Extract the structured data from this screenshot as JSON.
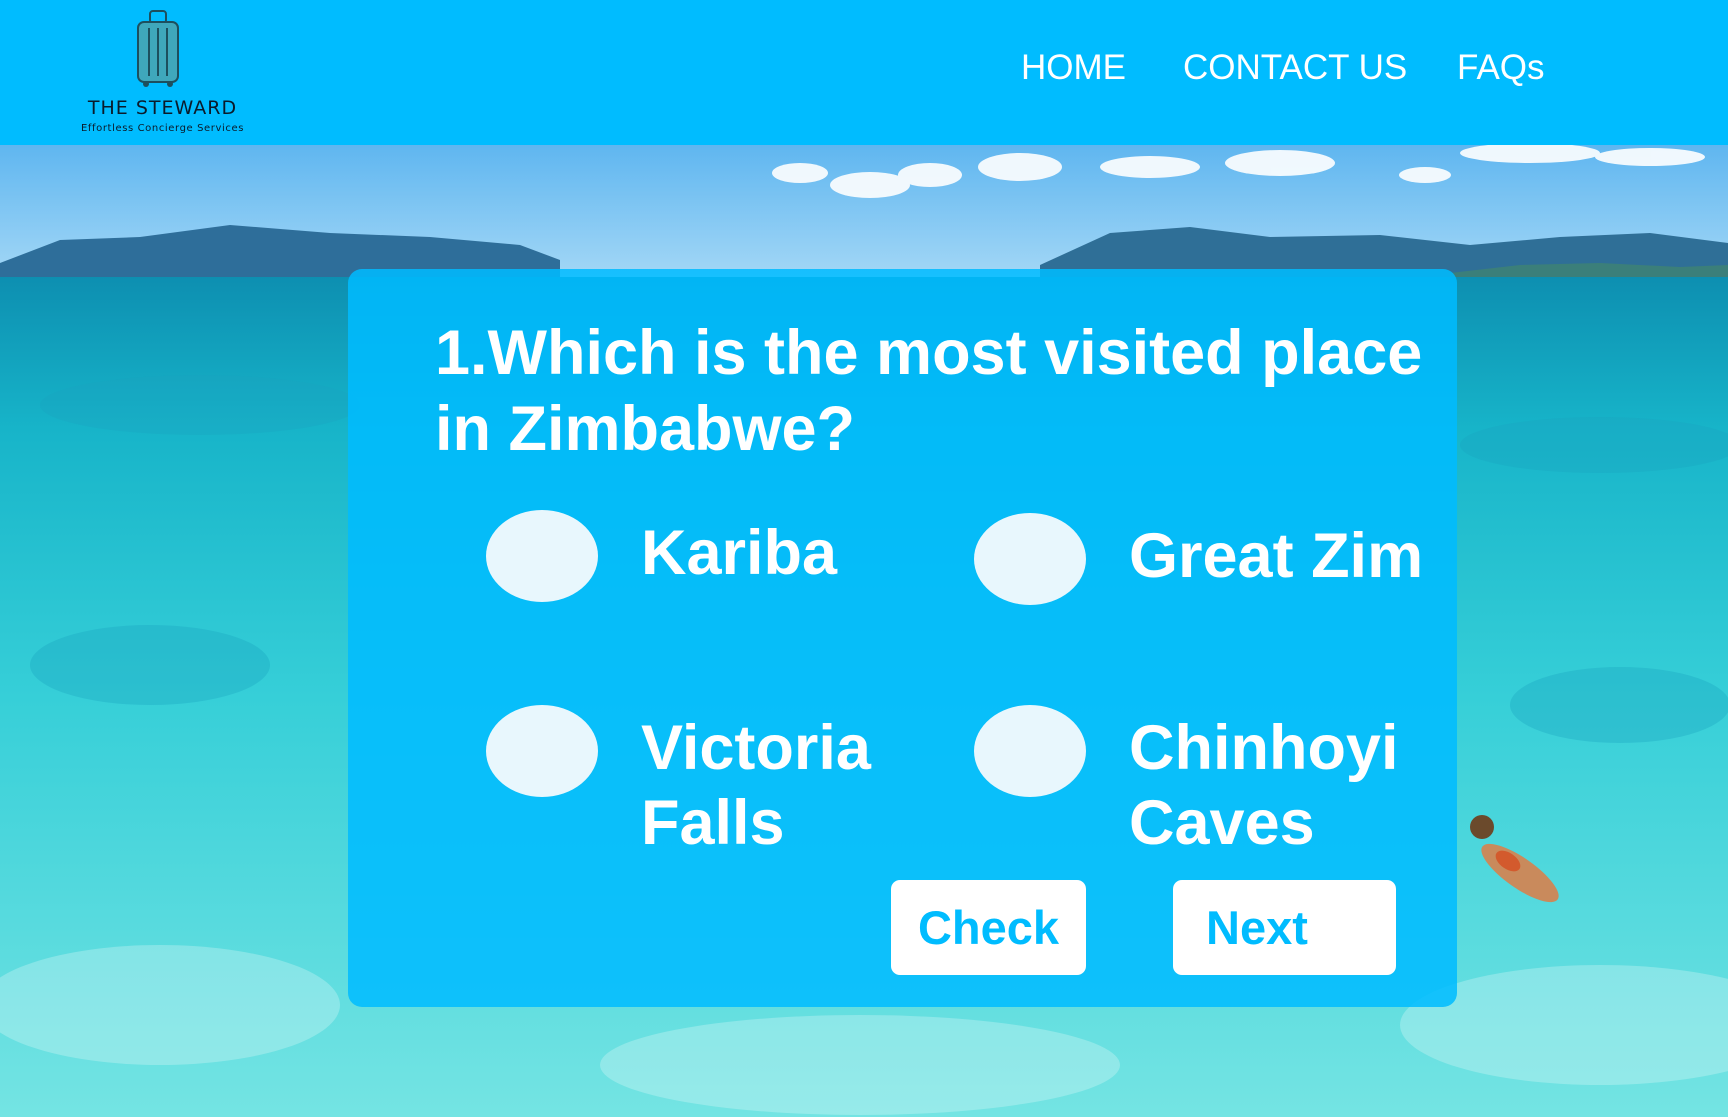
{
  "brand": {
    "name": "THE STEWARD",
    "tagline": "Effortless Concierge Services",
    "logo_icon": "suitcase-icon"
  },
  "nav": {
    "items": [
      {
        "label": "HOME"
      },
      {
        "label": "CONTACT US"
      },
      {
        "label": "FAQs"
      }
    ]
  },
  "quiz": {
    "question": "1.Which is the most visited place in Zimbabwe?",
    "options": [
      {
        "label": "Kariba",
        "selected": false
      },
      {
        "label": "Great Zim",
        "selected": false
      },
      {
        "label": "Victoria Falls",
        "selected": false
      },
      {
        "label": "Chinhoyi Caves",
        "selected": false
      }
    ],
    "check_label": "Check",
    "next_label": "Next"
  },
  "colors": {
    "header_bg": "#00bcff",
    "card_bg": "#00bcff",
    "accent": "#00bcff",
    "text_on_accent": "#ffffff",
    "radio_fill": "#e8f7fd"
  }
}
